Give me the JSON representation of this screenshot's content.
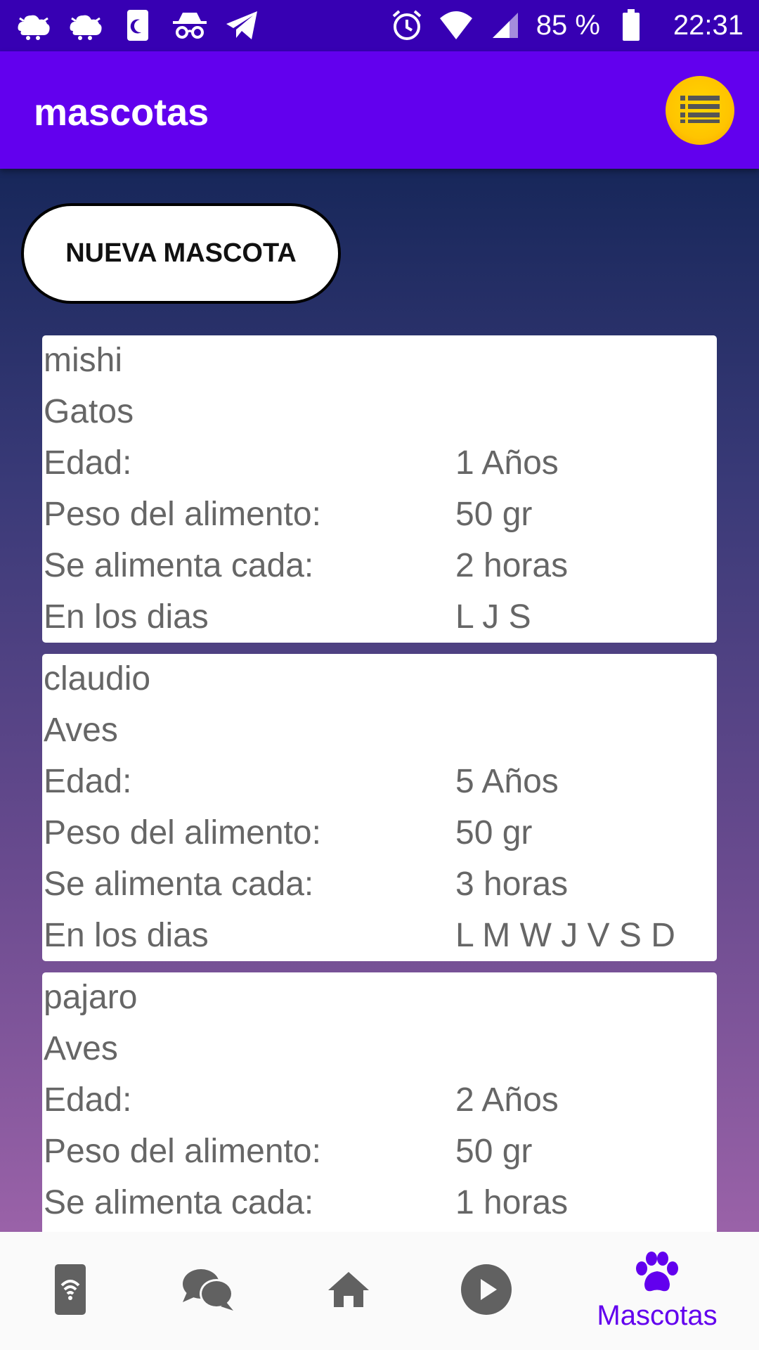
{
  "status_bar": {
    "battery_percent": "85 %",
    "time": "22:31",
    "left_icons": [
      "cloud-bug-icon",
      "cloud-bug-icon",
      "sim-moon-icon",
      "incognito-icon",
      "telegram-icon"
    ],
    "right_icons": [
      "alarm-icon",
      "wifi-icon",
      "signal-icon",
      "battery-icon"
    ]
  },
  "app_bar": {
    "title": "mascotas",
    "menu_icon": "list-menu-icon"
  },
  "new_pet_button": "NUEVA MASCOTA",
  "labels": {
    "age": "Edad:",
    "food_weight": "Peso del alimento:",
    "feed_every": "Se alimenta cada:",
    "days": "En los dias"
  },
  "pets": [
    {
      "name": "mishi",
      "type": "Gatos",
      "age": "1 Años",
      "food_weight": "50 gr",
      "feed_every": "2 horas",
      "days": "L J S"
    },
    {
      "name": "claudio",
      "type": "Aves",
      "age": "5 Años",
      "food_weight": "50 gr",
      "feed_every": "3 horas",
      "days": "L M W J V S D"
    },
    {
      "name": "pajaro",
      "type": "Aves",
      "age": "2 Años",
      "food_weight": "50 gr",
      "feed_every": "1 horas"
    }
  ],
  "bottom_nav": {
    "items": [
      {
        "icon": "phone-wifi-icon"
      },
      {
        "icon": "chat-icon"
      },
      {
        "icon": "home-icon"
      },
      {
        "icon": "play-icon"
      },
      {
        "icon": "paw-icon",
        "label": "Mascotas",
        "active": true
      }
    ]
  },
  "colors": {
    "status_bar": "#3700b3",
    "app_bar": "#6200ee",
    "accent": "#6200ee",
    "menu_button": "#ffc400"
  }
}
